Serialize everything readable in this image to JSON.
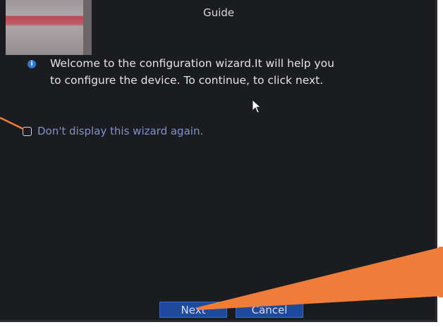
{
  "dialog": {
    "title": "Guide",
    "message": "Welcome to the configuration wizard.It will help you to configure the device. To continue, to click next.",
    "checkbox_label": "Don't display this wizard again.",
    "checkbox_checked": false
  },
  "buttons": {
    "next_label": "Next",
    "cancel_label": "Cancel"
  },
  "colors": {
    "background": "#1b1c20",
    "button": "#1f4a9c",
    "annotation": "#f07c3a",
    "link_text": "#7f93c9"
  }
}
